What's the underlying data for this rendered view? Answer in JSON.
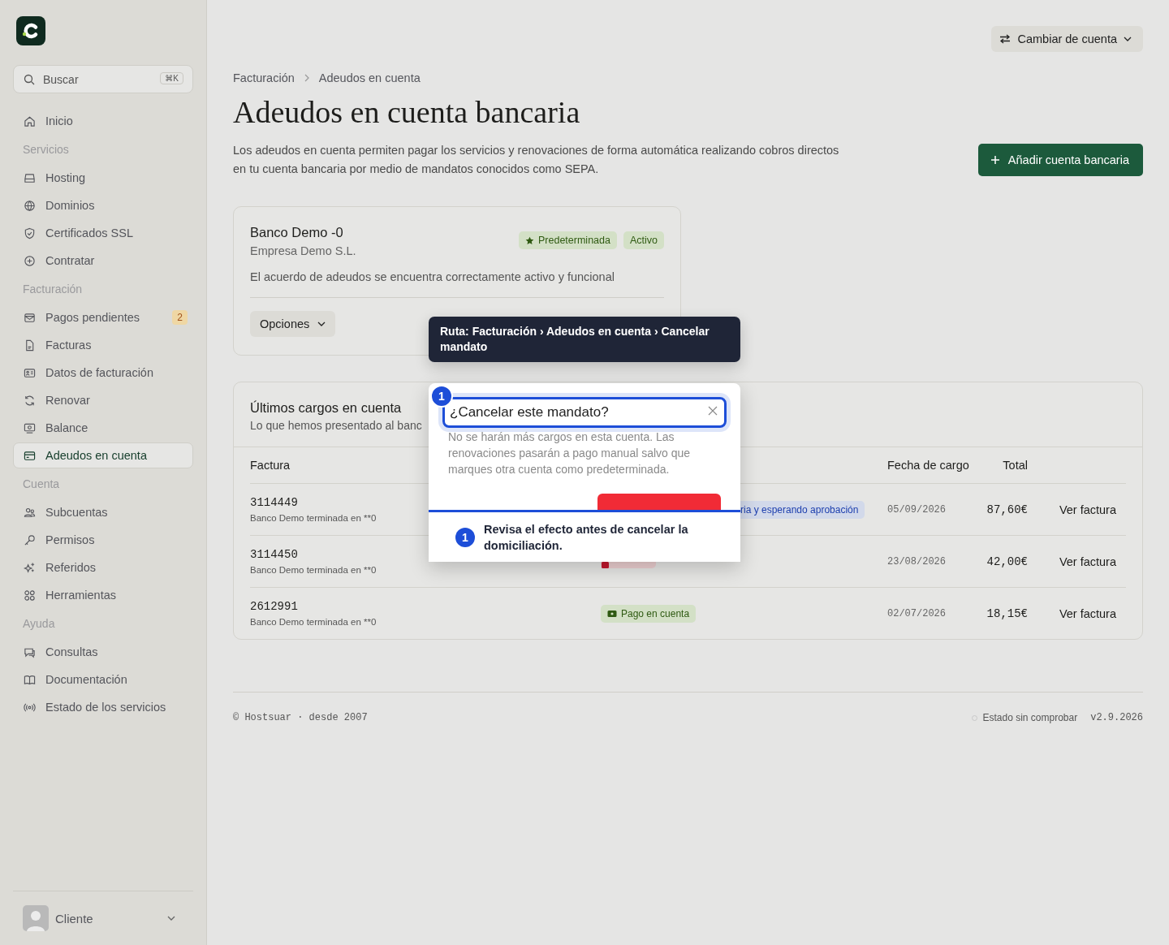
{
  "sidebar": {
    "search": {
      "placeholder": "Buscar",
      "shortcut": "⌘K"
    },
    "nav": [
      {
        "kind": "item",
        "label": "Inicio",
        "selected": false
      },
      {
        "kind": "section",
        "label": "Servicios"
      },
      {
        "kind": "item",
        "label": "Hosting",
        "selected": false
      },
      {
        "kind": "item",
        "label": "Dominios",
        "selected": false
      },
      {
        "kind": "item",
        "label": "Certificados SSL",
        "selected": false
      },
      {
        "kind": "item",
        "label": "Contratar",
        "selected": false
      },
      {
        "kind": "section",
        "label": "Facturación"
      },
      {
        "kind": "item",
        "label": "Pagos pendientes",
        "selected": false,
        "badge": "2"
      },
      {
        "kind": "item",
        "label": "Facturas",
        "selected": false
      },
      {
        "kind": "item",
        "label": "Datos de facturación",
        "selected": false
      },
      {
        "kind": "item",
        "label": "Renovar",
        "selected": false
      },
      {
        "kind": "item",
        "label": "Balance",
        "selected": false
      },
      {
        "kind": "item",
        "label": "Adeudos en cuenta",
        "selected": true
      },
      {
        "kind": "section",
        "label": "Cuenta"
      },
      {
        "kind": "item",
        "label": "Subcuentas",
        "selected": false
      },
      {
        "kind": "item",
        "label": "Permisos",
        "selected": false
      },
      {
        "kind": "item",
        "label": "Referidos",
        "selected": false
      },
      {
        "kind": "item",
        "label": "Herramientas",
        "selected": false
      },
      {
        "kind": "section",
        "label": "Ayuda"
      },
      {
        "kind": "item",
        "label": "Consultas",
        "selected": false
      },
      {
        "kind": "item",
        "label": "Documentación",
        "selected": false
      },
      {
        "kind": "item",
        "label": "Estado de los servicios",
        "selected": false
      }
    ],
    "user": {
      "name": "Cliente"
    }
  },
  "topbar": {
    "switch_account": "Cambiar de cuenta"
  },
  "breadcrumb": [
    "Facturación",
    "Adeudos en cuenta"
  ],
  "title": "Adeudos en cuenta bancaria",
  "description": "Los adeudos en cuenta permiten pagar los servicios y renovaciones de forma automática realizando cobros directos en tu cuenta bancaria por medio de mandatos conocidos como SEPA.",
  "add_button": "Añadir cuenta bancaria",
  "account_card": {
    "bank": "Banco Demo -0",
    "holder": "Empresa Demo S.L.",
    "tags": [
      {
        "kind": "default",
        "label": "Predeterminada"
      },
      {
        "kind": "status",
        "label": "Activo"
      }
    ],
    "message": "El acuerdo de adeudos se encuentra correctamente activo y funcional",
    "options": "Opciones"
  },
  "charges": {
    "title": "Últimos cargos en cuenta",
    "subtitle": "Lo que hemos presentado al banc",
    "columns": [
      "Factura",
      "Fecha de cargo",
      "Total"
    ],
    "rows": [
      {
        "invoice": "3114449",
        "account": "Banco Demo terminada en **0",
        "status": {
          "kind": "pending",
          "label": "ria y esperando aprobación"
        },
        "date": "05/09/2026",
        "total": "87,60€",
        "action": "Ver factura"
      },
      {
        "invoice": "3114450",
        "account": "Banco Demo terminada en **0",
        "status": {
          "kind": "failed"
        },
        "date": "23/08/2026",
        "total": "42,00€",
        "action": "Ver factura"
      },
      {
        "invoice": "2612991",
        "account": "Banco Demo terminada en **0",
        "status": {
          "kind": "paid",
          "label": "Pago en cuenta"
        },
        "date": "02/07/2026",
        "total": "18,15€",
        "action": "Ver factura"
      }
    ]
  },
  "footer": {
    "copyright": "© Hostsuar · desde 2007",
    "status": "Estado sin comprobar",
    "version": "v2.9.2026"
  },
  "tooltip": "Ruta: Facturación › Adeudos en cuenta › Cancelar mandato",
  "dialog": {
    "step": "1",
    "title": "¿Cancelar este mandato?",
    "text": "No se harán más cargos en esta cuenta. Las renovaciones pasarán a pago manual salvo que marques otra cuenta como predeterminada.",
    "buttons": [
      {
        "kind": "danger"
      }
    ]
  },
  "callout": {
    "step": "1",
    "text": "Revisa el efecto antes de cancelar la domiciliación."
  }
}
